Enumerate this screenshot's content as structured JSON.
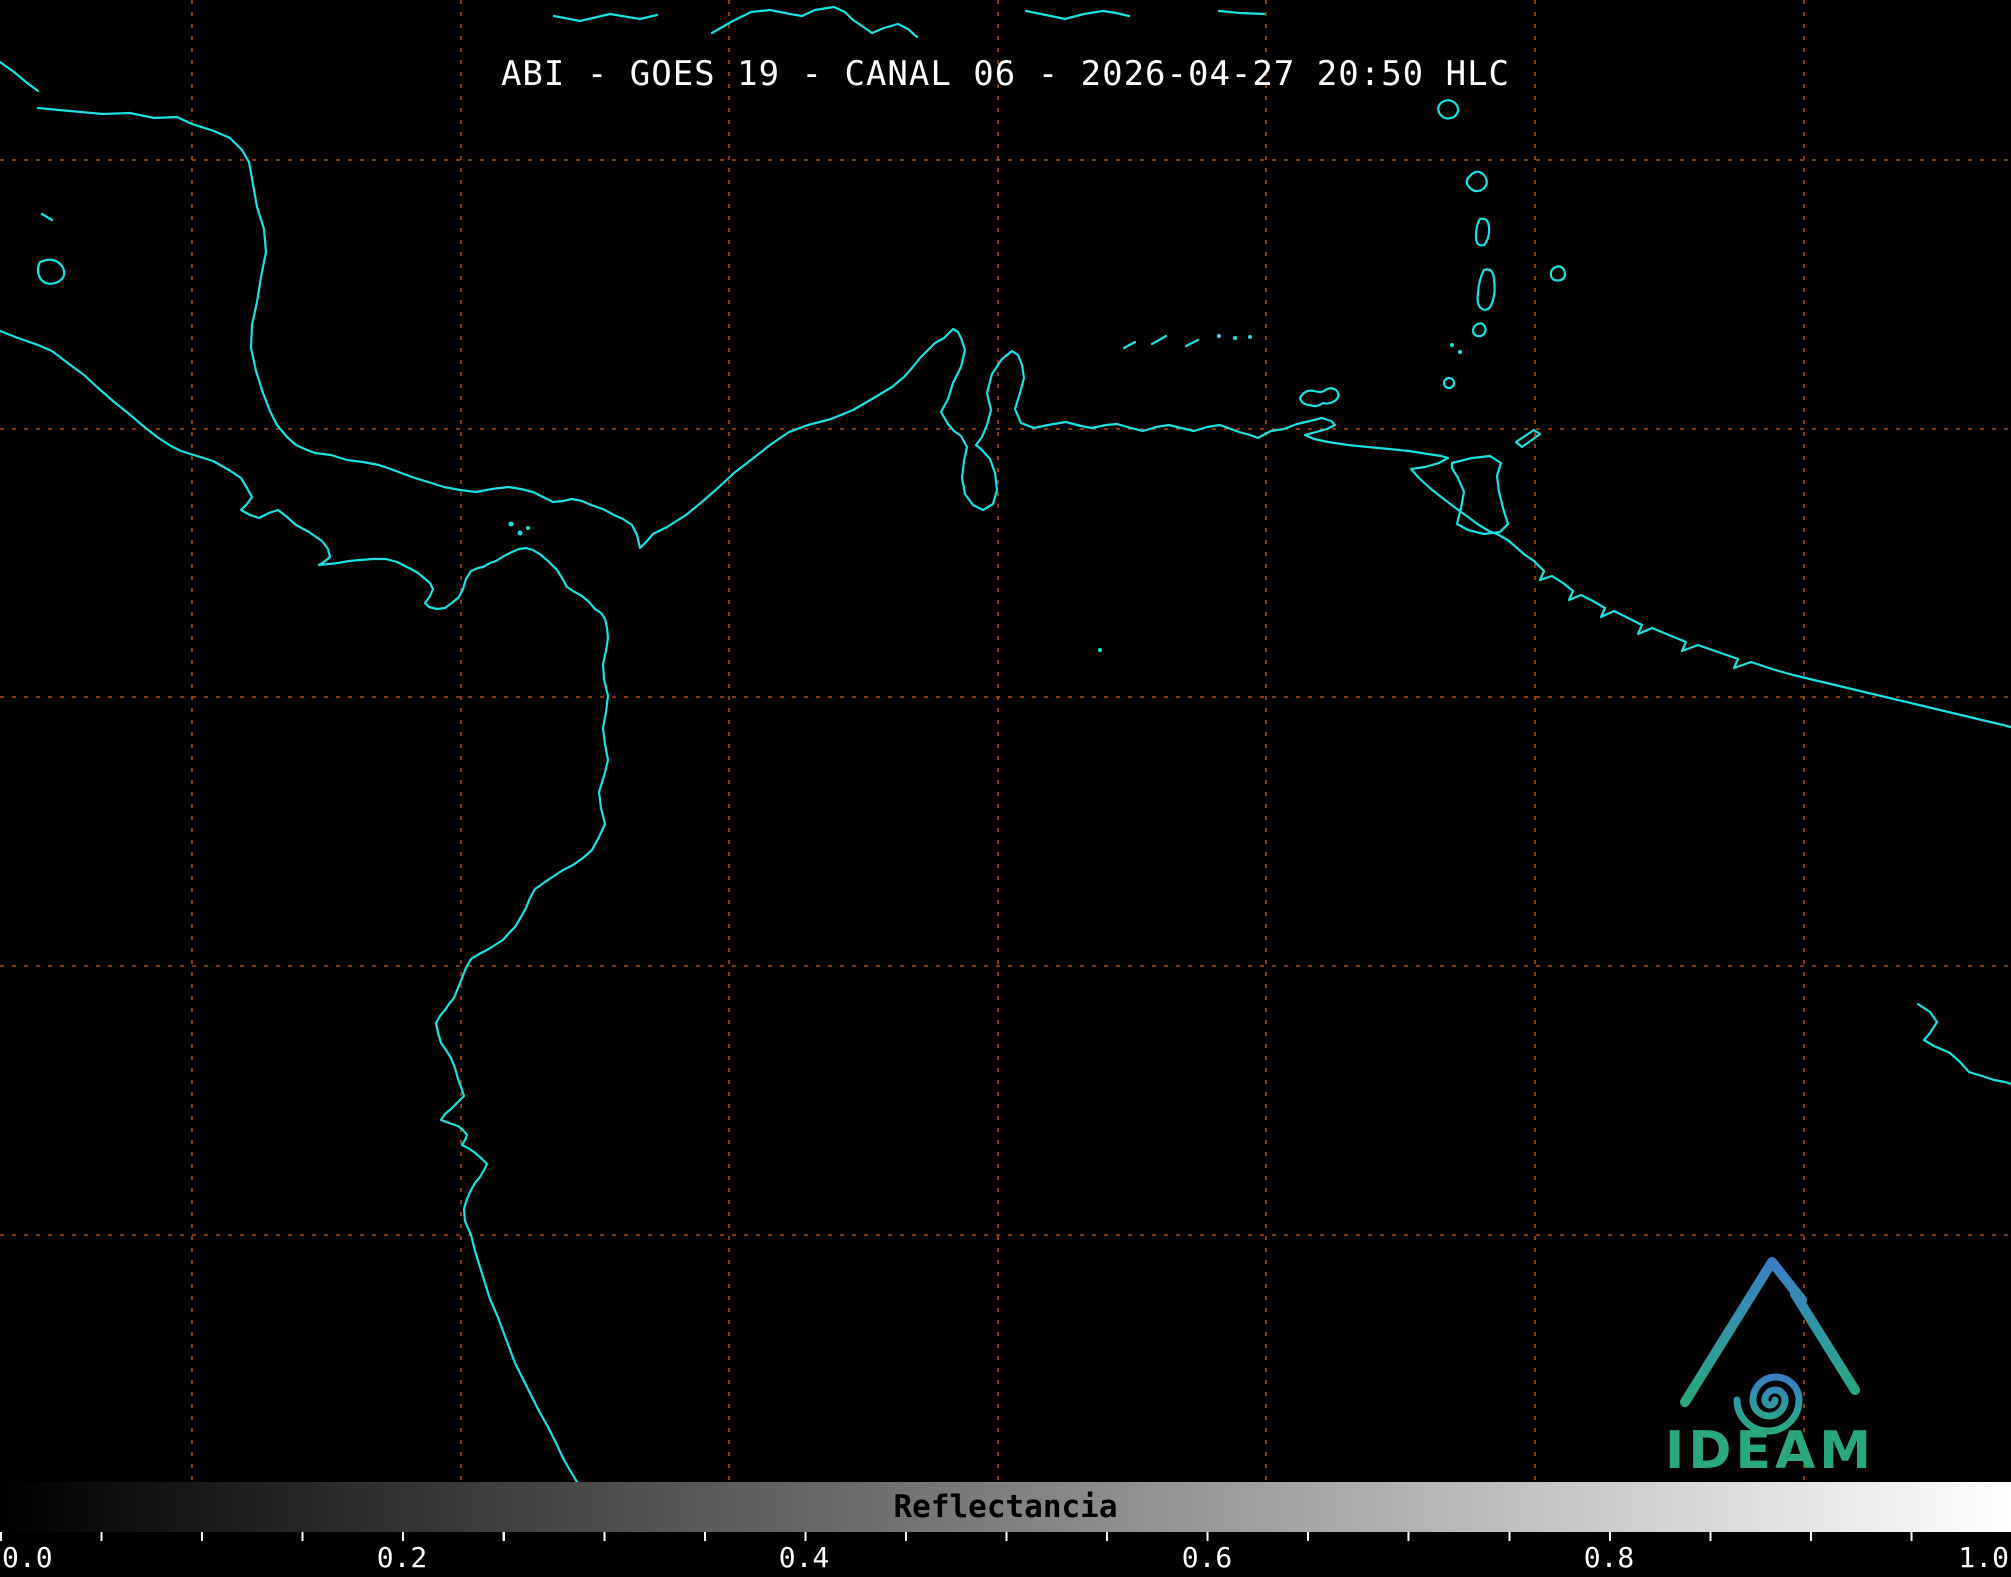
{
  "header": {
    "title": "ABI - GOES 19 - CANAL 06 - 2026-04-27 20:50 HLC"
  },
  "map": {
    "background_color": "#000000",
    "coastline_color": "#1fe0e0",
    "graticule_color": "#b14a00"
  },
  "colorbar": {
    "label": "Reflectancia",
    "min": "0.0",
    "max": "1.0",
    "ticks": [
      "0.0",
      "0.2",
      "0.4",
      "0.6",
      "0.8",
      "1.0"
    ],
    "gradient_start": "#000000",
    "gradient_end": "#ffffff"
  },
  "logo": {
    "text": "IDEAM",
    "color_top": "#3b7dc4",
    "color_bottom": "#2aa87c"
  }
}
